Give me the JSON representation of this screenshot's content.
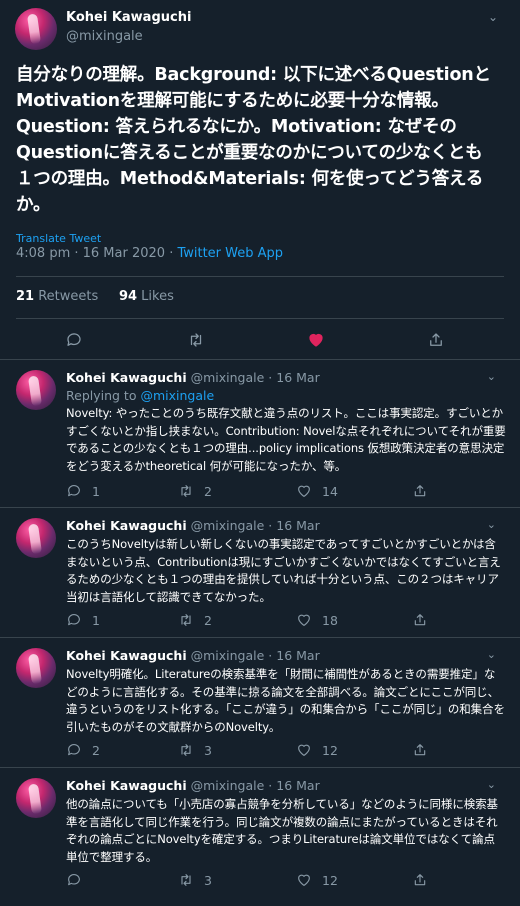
{
  "main": {
    "author_name": "Kohei Kawaguchi",
    "author_handle": "@mixingale",
    "caret": "⌄",
    "text": "自分なりの理解。Background: 以下に述べるQuestionとMotivationを理解可能にするために必要十分な情報。Question: 答えられるなにか。Motivation: なぜそのQuestionに答えることが重要なのかについての少なくとも１つの理由。Method&Materials: 何を使ってどう答えるか。",
    "translate": "Translate Tweet",
    "time": "4:08 pm · 16 Mar 2020 · ",
    "source": "Twitter Web App",
    "retweet_count": "21",
    "retweet_label": " Retweets",
    "like_count": "94",
    "like_label": " Likes"
  },
  "replies": [
    {
      "name": "Kohei Kawaguchi",
      "handle": "@mixingale",
      "date": "· 16 Mar",
      "replying_prefix": "Replying to ",
      "replying_to": "@mixingale",
      "text": "Novelty: やったことのうち既存文献と違う点のリスト。ここは事実認定。すごいとかすごくないとか指し挟まない。Contribution: Novelな点それぞれについてそれが重要であることの少なくとも１つの理由...policy implications 仮想政策決定者の意思決定をどう変えるかtheoretical 何が可能になったか、等。",
      "replies": "1",
      "retweets": "2",
      "likes": "14"
    },
    {
      "name": "Kohei Kawaguchi",
      "handle": "@mixingale",
      "date": "· 16 Mar",
      "text": "このうちNoveltyは新しい新しくないの事実認定であってすごいとかすごいとかは含まないという点、Contributionは現にすごいかすごくないかではなくてすごいと言えるための少なくとも１つの理由を提供していれば十分という点、この２つはキャリア当初は言語化して認識できてなかった。",
      "replies": "1",
      "retweets": "2",
      "likes": "18"
    },
    {
      "name": "Kohei Kawaguchi",
      "handle": "@mixingale",
      "date": "· 16 Mar",
      "text": "Novelty明確化。Literatureの検索基準を「財間に補間性があるときの需要推定」などのように言語化する。その基準に掠る論文を全部調べる。論文ごとにここが同じ、違うというのをリスト化する。「ここが違う」の和集合から「ここが同じ」の和集合を引いたものがその文献群からのNovelty。",
      "replies": "2",
      "retweets": "3",
      "likes": "12"
    },
    {
      "name": "Kohei Kawaguchi",
      "handle": "@mixingale",
      "date": "· 16 Mar",
      "text": "他の論点についても「小売店の寡占競争を分析している」などのように同様に検索基準を言語化して同じ作業を行う。同じ論文が複数の論点にまたがっているときはそれぞれの論点ごとにNoveltyを確定する。つまりLiteratureは論文単位ではなくて論点単位で整理する。",
      "replies": "",
      "retweets": "3",
      "likes": "12"
    }
  ],
  "colors": {
    "background": "#15202b",
    "muted": "#8899a6",
    "accent": "#1da1f2",
    "like": "#e0245e",
    "border": "#38444d"
  },
  "icons": [
    "reply-icon",
    "retweet-icon",
    "heart-icon",
    "share-icon",
    "chevron-down-icon"
  ]
}
